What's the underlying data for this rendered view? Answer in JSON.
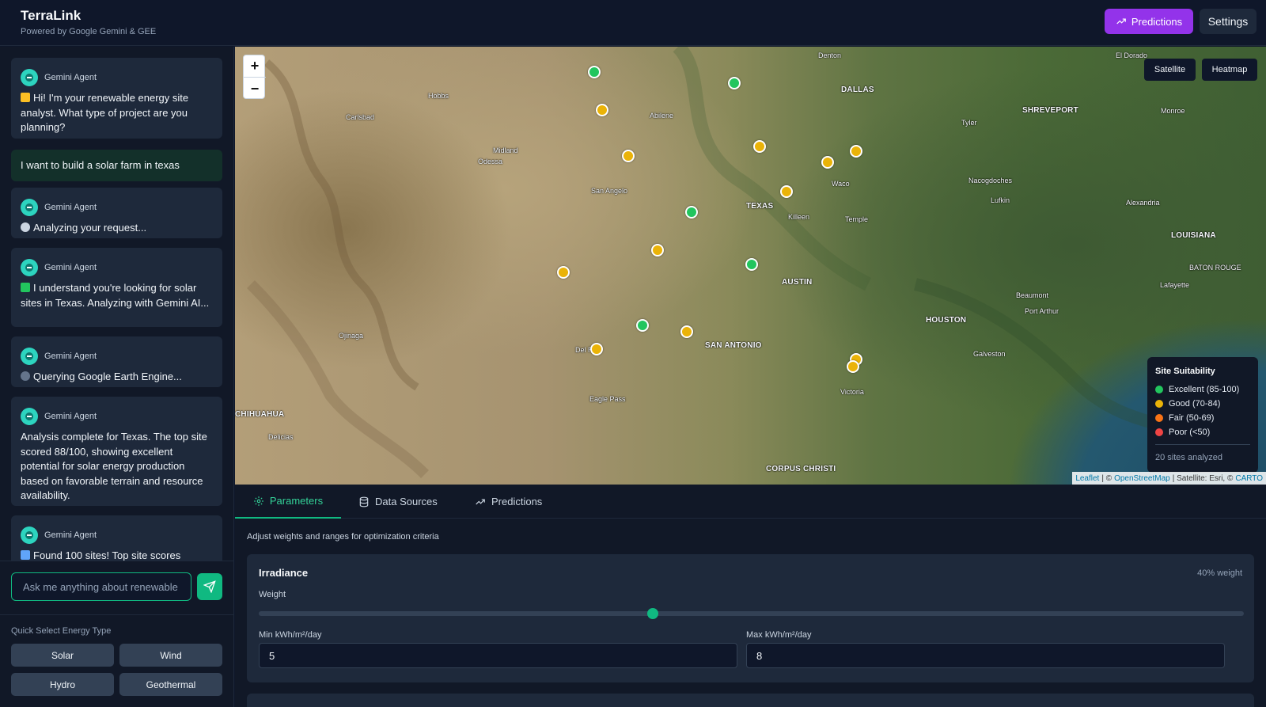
{
  "header": {
    "title": "TerraLink",
    "subtitle": "Powered by Google Gemini & GEE",
    "predictions_label": "Predictions",
    "settings_label": "Settings",
    "accent_color": "#9333ea"
  },
  "chat": {
    "agent_name": "Gemini Agent",
    "messages": [
      {
        "role": "agent",
        "text": "Hi! I'm your renewable energy site analyst. What type of project are you planning?"
      },
      {
        "role": "user",
        "text": "I want to build a solar farm in texas"
      },
      {
        "role": "agent",
        "text": "Analyzing your request..."
      },
      {
        "role": "agent",
        "text": "I understand you're looking for solar sites in Texas. Analyzing with Gemini AI..."
      },
      {
        "role": "agent",
        "text": "Querying Google Earth Engine..."
      },
      {
        "role": "agent",
        "text": "Analysis complete for Texas. The top site scored 88/100, showing excellent potential for solar energy production based on favorable terrain and resource availability."
      },
      {
        "role": "agent",
        "text": "Found 100 sites! Top site scores"
      }
    ],
    "input_placeholder": "Ask me anything about renewable energy sites...",
    "input_value": ""
  },
  "quick_select": {
    "label": "Quick Select Energy Type",
    "options": [
      "Solar",
      "Wind",
      "Hydro",
      "Geothermal"
    ]
  },
  "map": {
    "zoom_in": "+",
    "zoom_out": "−",
    "layer_buttons": [
      "Satellite",
      "Heatmap"
    ],
    "place_labels": {
      "denton": "Denton",
      "dallas": "DALLAS",
      "hobbs": "Hobbs",
      "carlsbad": "Carlsbad",
      "abilene": "Abilene",
      "midland": "Midland",
      "odessa": "Odessa",
      "san_angelo": "San Angelo",
      "texas": "TEXAS",
      "killeen": "Killeen",
      "temple": "Temple",
      "waco": "Waco",
      "austin": "AUSTIN",
      "san_antonio": "SAN ANTONIO",
      "del_rio": "Del Rio",
      "eagle_pass": "Eagle Pass",
      "ojinaga": "Ojinaga",
      "chihuahua": "CHIHUAHUA",
      "delicias": "Delicias",
      "victoria": "Victoria",
      "corpus_christi": "CORPUS CHRISTI",
      "houston": "HOUSTON",
      "galveston": "Galveston",
      "beaumont": "Beaumont",
      "port_arthur": "Port Arthur",
      "shreveport": "SHREVEPORT",
      "tyler": "Tyler",
      "monroe": "Monroe",
      "nacogdoches": "Nacogdoches",
      "lufkin": "Lufkin",
      "alexandria": "Alexandria",
      "louisiana": "LOUISIANA",
      "baton_rouge": "BATON ROUGE",
      "lafayette": "Lafayette",
      "el_dorado": "El Dorado"
    },
    "legend": {
      "title": "Site Suitability",
      "items": [
        {
          "label": "Excellent (85-100)",
          "color": "#22c55e"
        },
        {
          "label": "Good (70-84)",
          "color": "#eab308"
        },
        {
          "label": "Fair (50-69)",
          "color": "#f97316"
        },
        {
          "label": "Poor (<50)",
          "color": "#ef4444"
        }
      ],
      "footer": "20 sites analyzed"
    },
    "attribution": {
      "leaflet": "Leaflet",
      "sep1": "| ©",
      "osm": "OpenStreetMap",
      "sep2": "| Satellite: Esri, ©",
      "carto": "CARTO"
    }
  },
  "panel": {
    "tabs": [
      "Parameters",
      "Data Sources",
      "Predictions"
    ],
    "active_tab": "Parameters",
    "hint": "Adjust weights and ranges for optimization criteria",
    "criterion": {
      "title": "Irradiance",
      "weight_text": "40% weight",
      "weight_label": "Weight",
      "weight_value": 0.4,
      "min_label": "Min kWh/m²/day",
      "min_value": "5",
      "max_label": "Max kWh/m²/day",
      "max_value": "8"
    }
  }
}
